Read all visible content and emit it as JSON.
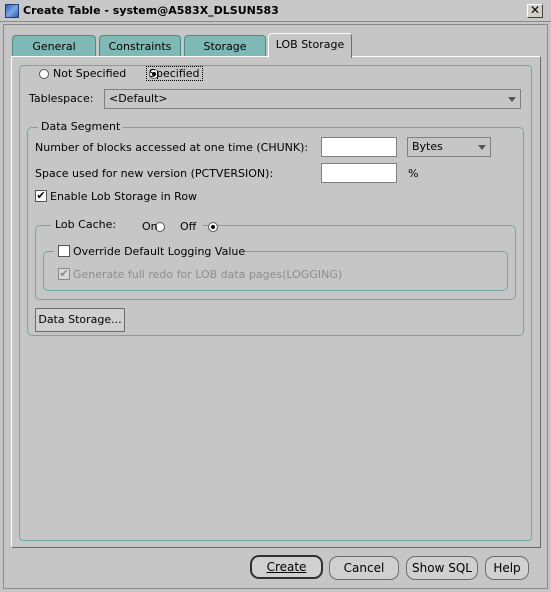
{
  "window": {
    "title": "Create Table - system@A583X_DLSUN583",
    "close_glyph": "✕"
  },
  "tabs": [
    {
      "label": "General"
    },
    {
      "label": "Constraints"
    },
    {
      "label": "Storage"
    },
    {
      "label": "LOB Storage",
      "active": true
    }
  ],
  "lob_storage": {
    "mode_not_specified": "Not Specified",
    "mode_specified": "Specified",
    "selected_mode": "Specified",
    "tablespace_label": "Tablespace:",
    "tablespace_value": "<Default>",
    "data_segment": {
      "legend": "Data Segment",
      "chunk_label": "Number of blocks accessed at one time (CHUNK):",
      "chunk_value": "",
      "chunk_unit": "Bytes",
      "pctversion_label": "Space used for new version (PCTVERSION):",
      "pctversion_value": "",
      "pctversion_unit": "%",
      "enable_in_row_label": "Enable Lob Storage in Row",
      "enable_in_row_checked": true,
      "lob_cache": {
        "legend": "Lob Cache:",
        "on_label": "On",
        "off_label": "Off",
        "selected": "Off",
        "override_logging_label": "Override Default Logging Value",
        "override_logging_checked": false,
        "generate_redo_label": "Generate full redo for LOB data pages(LOGGING)",
        "generate_redo_checked": true,
        "generate_redo_enabled": false
      },
      "data_storage_button": "Data Storage..."
    }
  },
  "footer": {
    "create": "Create",
    "cancel": "Cancel",
    "show_sql": "Show SQL",
    "help": "Help"
  },
  "icons": {
    "app": "create-table-icon",
    "check": "✔"
  }
}
